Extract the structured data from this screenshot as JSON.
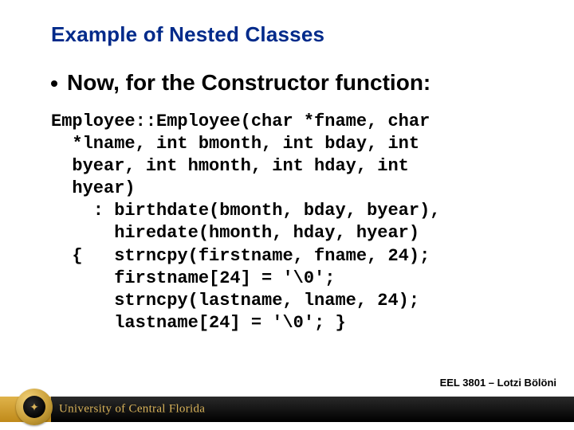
{
  "slide": {
    "title": "Example of Nested Classes",
    "bullet": "Now, for the Constructor function:",
    "code": "Employee::Employee(char *fname, char\n  *lname, int bmonth, int bday, int\n  byear, int hmonth, int hday, int\n  hyear)\n    : birthdate(bmonth, bday, byear),\n      hiredate(hmonth, hday, hyear)\n  {   strncpy(firstname, fname, 24);\n      firstname[24] = '\\0';\n      strncpy(lastname, lname, 24);\n      lastname[24] = '\\0'; }"
  },
  "footer": {
    "university": "University of Central Florida",
    "course": "EEL 3801 – Lotzi Bölöni"
  }
}
